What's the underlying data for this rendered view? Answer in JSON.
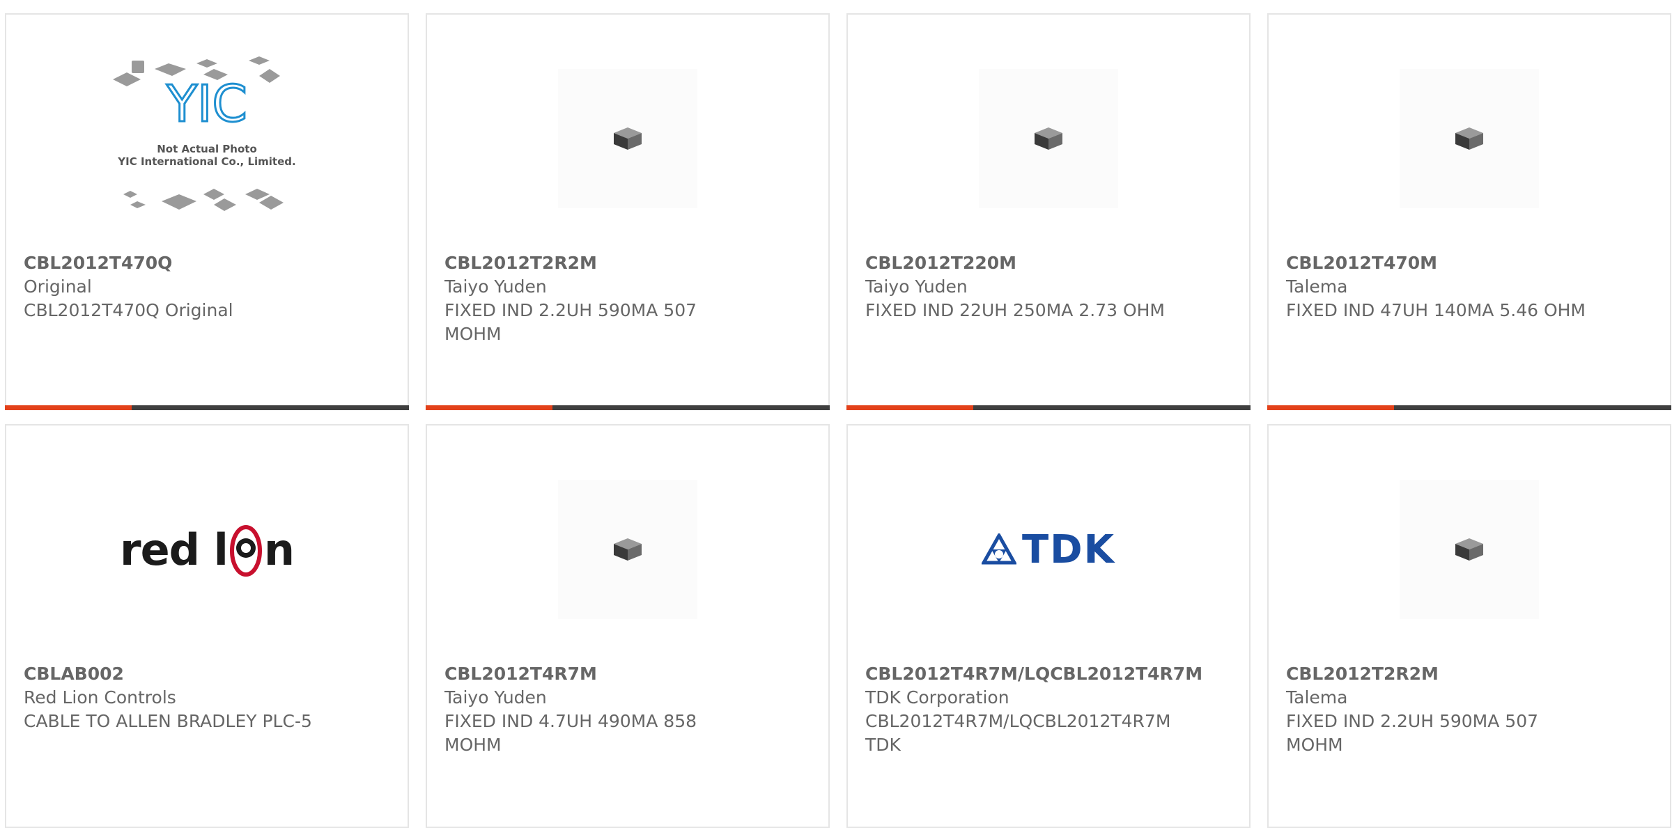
{
  "products": [
    {
      "part_number": "CBL2012T470Q",
      "manufacturer": "Original",
      "description": "CBL2012T470Q Original",
      "image": "yic-placeholder",
      "caption_line1": "Not Actual Photo",
      "caption_line2": "YIC International Co., Limited.",
      "logo_text": "YIC"
    },
    {
      "part_number": "CBL2012T2R2M",
      "manufacturer": "Taiyo Yuden",
      "description": "FIXED IND 2.2UH 590MA 507 MOHM",
      "image": "smd-inductor-chip"
    },
    {
      "part_number": "CBL2012T220M",
      "manufacturer": "Taiyo Yuden",
      "description": "FIXED IND 22UH 250MA 2.73 OHM",
      "image": "smd-inductor-chip"
    },
    {
      "part_number": "CBL2012T470M",
      "manufacturer": "Talema",
      "description": "FIXED IND 47UH 140MA 5.46 OHM",
      "image": "smd-inductor-chip"
    },
    {
      "part_number": "CBLAB002",
      "manufacturer": "Red Lion Controls",
      "description": "CABLE TO ALLEN BRADLEY PLC-5",
      "image": "red-lion-logo",
      "logo_text_a": "red l",
      "logo_text_b": "n"
    },
    {
      "part_number": "CBL2012T4R7M",
      "manufacturer": "Taiyo Yuden",
      "description": "FIXED IND 4.7UH 490MA 858 MOHM",
      "image": "smd-inductor-chip"
    },
    {
      "part_number": "CBL2012T4R7M/LQCBL2012T4R7M",
      "manufacturer": "TDK Corporation",
      "description": "CBL2012T4R7M/LQCBL2012T4R7M TDK",
      "image": "tdk-logo",
      "logo_text": "TDK"
    },
    {
      "part_number": "CBL2012T2R2M",
      "manufacturer": "Talema",
      "description": "FIXED IND 2.2UH 590MA 507 MOHM",
      "image": "smd-inductor-chip"
    }
  ],
  "colors": {
    "accent": "#e3411a",
    "bar": "#3f3f3f",
    "text": "#666666",
    "tdk_blue": "#1a4da1",
    "yic_blue": "#1e8fd0",
    "redlion_red": "#c8102e"
  }
}
